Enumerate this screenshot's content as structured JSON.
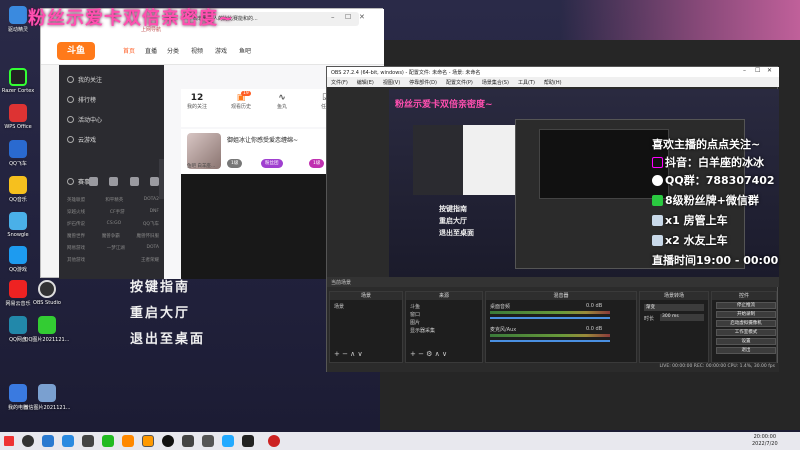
{
  "overlay": {
    "title": "粉丝示爱卡双倍亲密度~",
    "menu": [
      "按键指南",
      "重启大厅",
      "退出至桌面"
    ],
    "promo": [
      "喜欢主播的点点关注~",
      "抖音：白羊座的冰冰",
      "QQ群：788307402",
      "8级粉丝牌+微信群",
      "x1 房管上车",
      "x2 水友上车",
      "直播时间19:00 - 00:00"
    ]
  },
  "desktop_icons": [
    "驱动精灵",
    "Razer Cortex",
    "WPS Office",
    "QQ飞车",
    "QQ音乐",
    "Snowgle",
    "QQ游戏",
    "网易云音乐",
    "OBS Studio",
    "QQ网盘",
    "QQ图片2021121...",
    "我的电脑",
    "微信图片2021121..."
  ],
  "browser": {
    "tab_title": "微软雅黑人的比比赛能和的...",
    "address": "上网导航",
    "logo": "斗鱼",
    "nav_tabs": [
      "首页",
      "直播",
      "分类",
      "视频",
      "游戏",
      "鱼吧"
    ],
    "sidebar": [
      "我的关注",
      "排行榜",
      "活动中心",
      "云游戏",
      "赛事"
    ],
    "grid": [
      [
        "英雄联盟",
        "和平精英",
        "DOTA2"
      ],
      [
        "穿越火线",
        "CF手游",
        "DNF"
      ],
      [
        "炉石传说",
        "CS:GO",
        "QQ飞车"
      ],
      [
        "魔兽世界",
        "魔兽争霸",
        "魔兽怀旧服"
      ],
      [
        "网易游戏",
        "一梦江湖",
        "DOTA"
      ],
      [
        "其他游戏",
        "",
        "王者荣耀"
      ]
    ],
    "stats": [
      {
        "value": "12",
        "label": "我的关注"
      },
      {
        "value": "",
        "label": "观看历史"
      },
      {
        "value": "",
        "label": "鱼丸"
      },
      {
        "value": "",
        "label": "任务"
      }
    ],
    "stat_badge": "19",
    "video_title": "御姐冰让你感受爱恋缠绵~",
    "video_sub": "鱼吧 白羊座...",
    "pills": [
      "1级",
      "粉丝团",
      "1级"
    ]
  },
  "obs": {
    "title": "OBS 27.2.4 (64-bit, windows) - 配置文件: 未命名 - 场景: 未命名",
    "menu": [
      "文件(F)",
      "编辑(E)",
      "视图(V)",
      "停靠部件(D)",
      "配置文件(P)",
      "场景集合(S)",
      "工具(T)",
      "帮助(H)"
    ],
    "dock_bar": "当前场景",
    "scenes_head": "场景",
    "scenes": [
      "场景"
    ],
    "sources_head": "来源",
    "sources": [
      "斗鱼",
      "窗口",
      "图片",
      "显示器采集"
    ],
    "mixer_head": "混音器",
    "mixer": [
      {
        "name": "桌面音频",
        "db": "0.0 dB"
      },
      {
        "name": "麦克风/Aux",
        "db": "0.0 dB"
      }
    ],
    "transitions_head": "场景转场",
    "transition_value": "渐变",
    "duration_label": "时长",
    "duration_value": "300 ms",
    "controls_head": "控件",
    "controls": [
      "停止推流",
      "开始录制",
      "启动虚拟摄像机",
      "工作室模式",
      "设置",
      "退出"
    ],
    "status": "LIVE: 00:00:00  REC: 00:00:00  CPU: 1.4%, 30.00 fps"
  },
  "taskbar": {
    "time": "20:00:00",
    "date": "2022/7/20"
  }
}
